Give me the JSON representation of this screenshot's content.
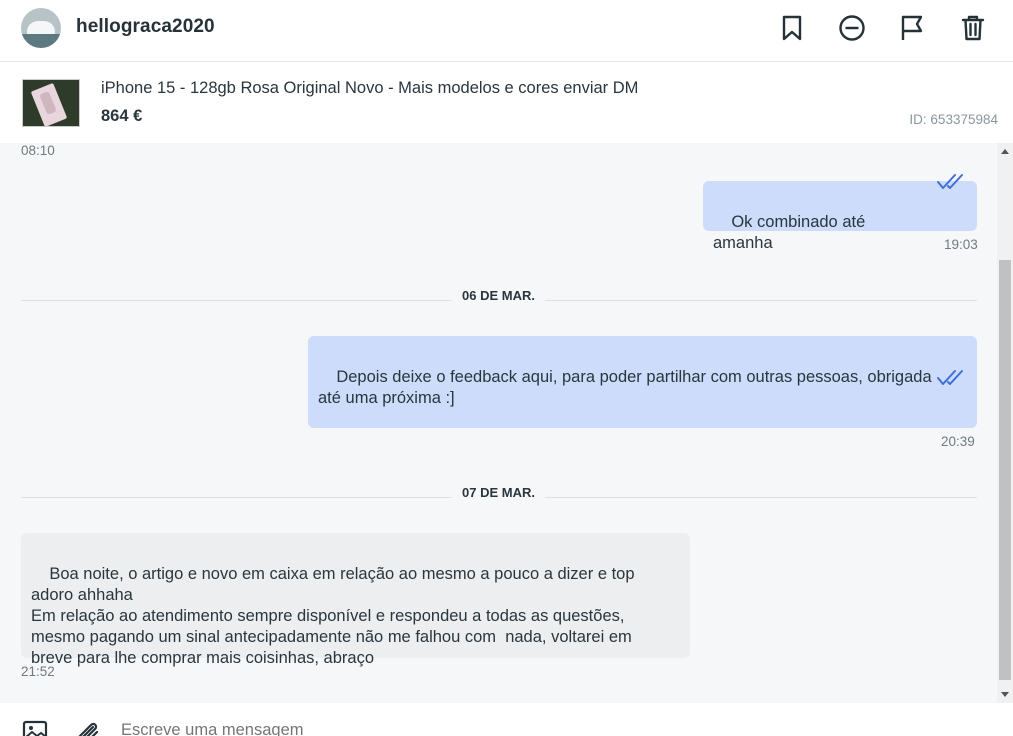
{
  "header": {
    "username": "hellograca2020",
    "icons": [
      "bookmark-icon",
      "block-icon",
      "flag-icon",
      "trash-icon"
    ]
  },
  "product": {
    "title": "iPhone 15 - 128gb Rosa Original Novo - Mais modelos e cores enviar DM",
    "price": "864 €",
    "id": "ID: 653375984"
  },
  "chat": {
    "top_time": "08:10",
    "msg1": {
      "text": "Ok combinado até amanha",
      "time": "19:03"
    },
    "date1": "06 DE MAR.",
    "msg2": {
      "text": "Depois deixe o feedback aqui, para poder partilhar com outras pessoas, obrigada\naté uma próxima :]",
      "time": "20:39"
    },
    "date2": "07 DE MAR.",
    "msg3": {
      "text": "Boa noite, o artigo e novo em caixa em relação ao mesmo a pouco a dizer e top\nadoro ahhaha\nEm relação ao atendimento sempre disponível e respondeu a todas as questões,\nmesmo pagando um sinal antecipadamente não me falhou com  nada, voltarei em\nbreve para lhe comprar mais coisinhas, abraço",
      "time": "21:52"
    }
  },
  "composer": {
    "placeholder": "Escreve uma mensagem"
  },
  "colors": {
    "outgoing_bubble": "#cddcfb",
    "incoming_bubble": "#eceeef",
    "read_ticks": "#3f6fd8"
  }
}
